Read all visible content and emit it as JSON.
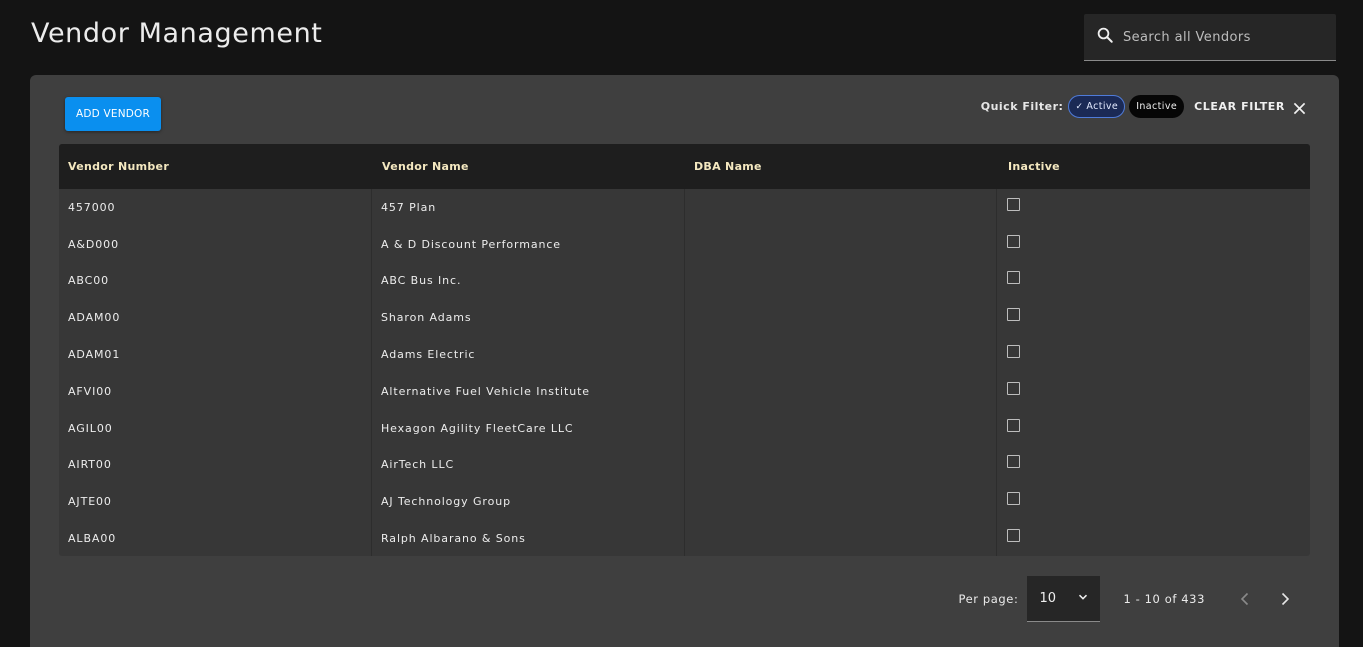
{
  "header": {
    "title": "Vendor Management"
  },
  "search": {
    "placeholder": "Search all Vendors",
    "icon": "search-icon"
  },
  "toolbar": {
    "add_label": "ADD VENDOR",
    "quick_filter_label": "Quick Filter:",
    "chips": [
      {
        "label": "Active",
        "selected": true
      },
      {
        "label": "Inactive",
        "selected": false
      }
    ],
    "clear_filter_label": "CLEAR FILTER"
  },
  "table": {
    "columns": [
      "Vendor Number",
      "Vendor Name",
      "DBA Name",
      "Inactive"
    ],
    "rows": [
      {
        "number": "457000",
        "name": "457 Plan",
        "dba": "",
        "inactive": false
      },
      {
        "number": "A&D000",
        "name": "A & D Discount Performance",
        "dba": "",
        "inactive": false
      },
      {
        "number": "ABC00",
        "name": "ABC Bus Inc.",
        "dba": "",
        "inactive": false
      },
      {
        "number": "ADAM00",
        "name": "Sharon Adams",
        "dba": "",
        "inactive": false
      },
      {
        "number": "ADAM01",
        "name": "Adams Electric",
        "dba": "",
        "inactive": false
      },
      {
        "number": "AFVI00",
        "name": "Alternative Fuel Vehicle Institute",
        "dba": "",
        "inactive": false
      },
      {
        "number": "AGIL00",
        "name": "Hexagon Agility FleetCare LLC",
        "dba": "",
        "inactive": false
      },
      {
        "number": "AIRT00",
        "name": "AirTech LLC",
        "dba": "",
        "inactive": false
      },
      {
        "number": "AJTE00",
        "name": "AJ Technology Group",
        "dba": "",
        "inactive": false
      },
      {
        "number": "ALBA00",
        "name": "Ralph Albarano & Sons",
        "dba": "",
        "inactive": false
      }
    ]
  },
  "pagination": {
    "per_page_label": "Per page:",
    "per_page_value": "10",
    "range_text": "1 - 10 of 433"
  },
  "colors": {
    "accent": "#0a8fef",
    "panel": "#3f3f3f",
    "background": "#141414",
    "header_text": "#f4e8c0"
  }
}
